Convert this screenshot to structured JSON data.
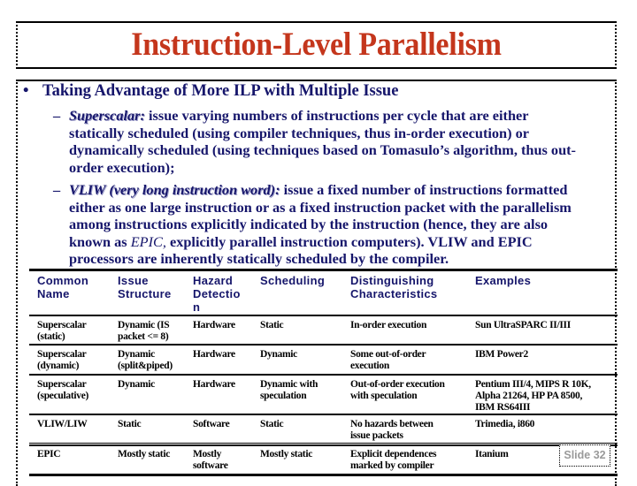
{
  "slide": {
    "title": "Instruction-Level Parallelism",
    "slide_number": "Slide 32"
  },
  "body": {
    "main_bullet": {
      "marker": "•",
      "text": "Taking Advantage of More ILP with Multiple Issue"
    },
    "sub_bullets": [
      {
        "marker": "–",
        "term": "Superscalar:",
        "lines": [
          " issue varying numbers of instructions per cycle that are either",
          "statically scheduled (using compiler techniques, thus in-order execution) or",
          "dynamically scheduled (using techniques based on Tomasulo’s algorithm, thus out-",
          "order execution);"
        ]
      },
      {
        "marker": "–",
        "term": "VLIW (very long instruction word):",
        "line1_rest": " issue a fixed number of instructions formatted",
        "line2": "either as one large instruction or as a fixed instruction packet with the parallelism",
        "line3": "among instructions explicitly indicated by the instruction (hence, they are also",
        "line4_pre": "known as ",
        "line4_em": "EPIC,",
        "line4_post": " explicitly parallel instruction computers). VLIW and EPIC",
        "line5": "processors are inherently statically scheduled by the compiler."
      }
    ]
  },
  "table": {
    "headers": [
      [
        "Common",
        "Name"
      ],
      [
        "Issue",
        "Structure"
      ],
      [
        "Hazard",
        "Detectio",
        "n"
      ],
      [
        "Scheduling"
      ],
      [
        "Distinguishing",
        "Characteristics"
      ],
      [
        "Examples"
      ]
    ],
    "rows": [
      [
        [
          "Superscalar",
          "(static)"
        ],
        [
          "Dynamic (IS",
          "packet <= 8)"
        ],
        [
          "Hardware"
        ],
        [
          "Static"
        ],
        [
          "In-order execution"
        ],
        [
          "Sun UltraSPARC II/III"
        ]
      ],
      [
        [
          "Superscalar",
          "(dynamic)"
        ],
        [
          "Dynamic",
          "(split&piped)"
        ],
        [
          "Hardware"
        ],
        [
          "Dynamic"
        ],
        [
          "Some out-of-order",
          "execution"
        ],
        [
          "IBM Power2"
        ]
      ],
      [
        [
          "Superscalar",
          "(speculative)"
        ],
        [
          "Dynamic"
        ],
        [
          "Hardware"
        ],
        [
          "Dynamic with",
          "speculation"
        ],
        [
          "Out-of-order execution",
          "with speculation"
        ],
        [
          "Pentium III/4, MIPS R 10K,",
          "Alpha 21264, HP PA 8500,",
          "IBM RS64III"
        ]
      ],
      [
        [
          "VLIW/LIW"
        ],
        [
          "Static"
        ],
        [
          "Software"
        ],
        [
          "Static"
        ],
        [
          "No hazards between",
          "issue packets"
        ],
        [
          "Trimedia, i860"
        ]
      ],
      [
        [
          "EPIC"
        ],
        [
          "Mostly static"
        ],
        [
          "Mostly",
          "software"
        ],
        [
          "Mostly static"
        ],
        [
          "Explicit dependences",
          "marked by compiler"
        ],
        [
          "Itanium"
        ]
      ]
    ]
  },
  "colors": {
    "title": "#c4361c",
    "body_text": "#16166b",
    "slide_number": "#9a9a9a"
  }
}
